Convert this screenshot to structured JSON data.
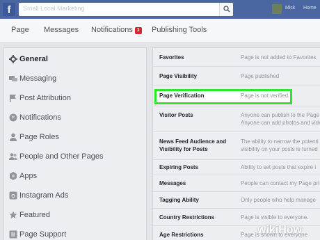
{
  "topbar": {
    "search_placeholder": "Small Local Marketing",
    "user_name": "Mick",
    "home_label": "Home"
  },
  "pagenav": {
    "items": [
      {
        "label": "Page"
      },
      {
        "label": "Messages"
      },
      {
        "label": "Notifications",
        "badge": "1"
      },
      {
        "label": "Publishing Tools"
      }
    ]
  },
  "sidebar": {
    "items": [
      {
        "label": "General",
        "icon": "gear-icon"
      },
      {
        "label": "Messaging",
        "icon": "chat-icon"
      },
      {
        "label": "Post Attribution",
        "icon": "flag-icon"
      },
      {
        "label": "Notifications",
        "icon": "globe-icon"
      },
      {
        "label": "Page Roles",
        "icon": "person-icon"
      },
      {
        "label": "People and Other Pages",
        "icon": "people-icon"
      },
      {
        "label": "Apps",
        "icon": "apps-icon"
      },
      {
        "label": "Instagram Ads",
        "icon": "instagram-icon"
      },
      {
        "label": "Featured",
        "icon": "star-icon"
      },
      {
        "label": "Page Support",
        "icon": "support-icon"
      }
    ]
  },
  "settings": {
    "rows": [
      {
        "label": "Favorites",
        "value": "Page is not added to Favorites"
      },
      {
        "label": "Page Visibility",
        "value": "Page published"
      },
      {
        "label": "Page Verification",
        "value": "Page is not verified"
      },
      {
        "label": "Visitor Posts",
        "value": "Anyone can publish to the Page",
        "value2": "Anyone can add photos and vide"
      },
      {
        "label": "News Feed Audience and",
        "label2": "Visibility for Posts",
        "value": "The ability to narrow the potenti",
        "value2": "visibility on your posts is turned"
      },
      {
        "label": "Expiring Posts",
        "value": "Ability to set posts that expire i"
      },
      {
        "label": "Messages",
        "value": "People can contact my Page pri"
      },
      {
        "label": "Tagging Ability",
        "value": "Only people who help manage"
      },
      {
        "label": "Country Restrictions",
        "value": "Page is visible to everyone."
      },
      {
        "label": "Age Restrictions",
        "value": "Page is shown to everyone"
      }
    ]
  },
  "watermark": {
    "text": "wikiHow"
  },
  "colors": {
    "fb_blue": "#4b67a1",
    "highlight": "#2ce62c",
    "badge_red": "#d6252f"
  }
}
